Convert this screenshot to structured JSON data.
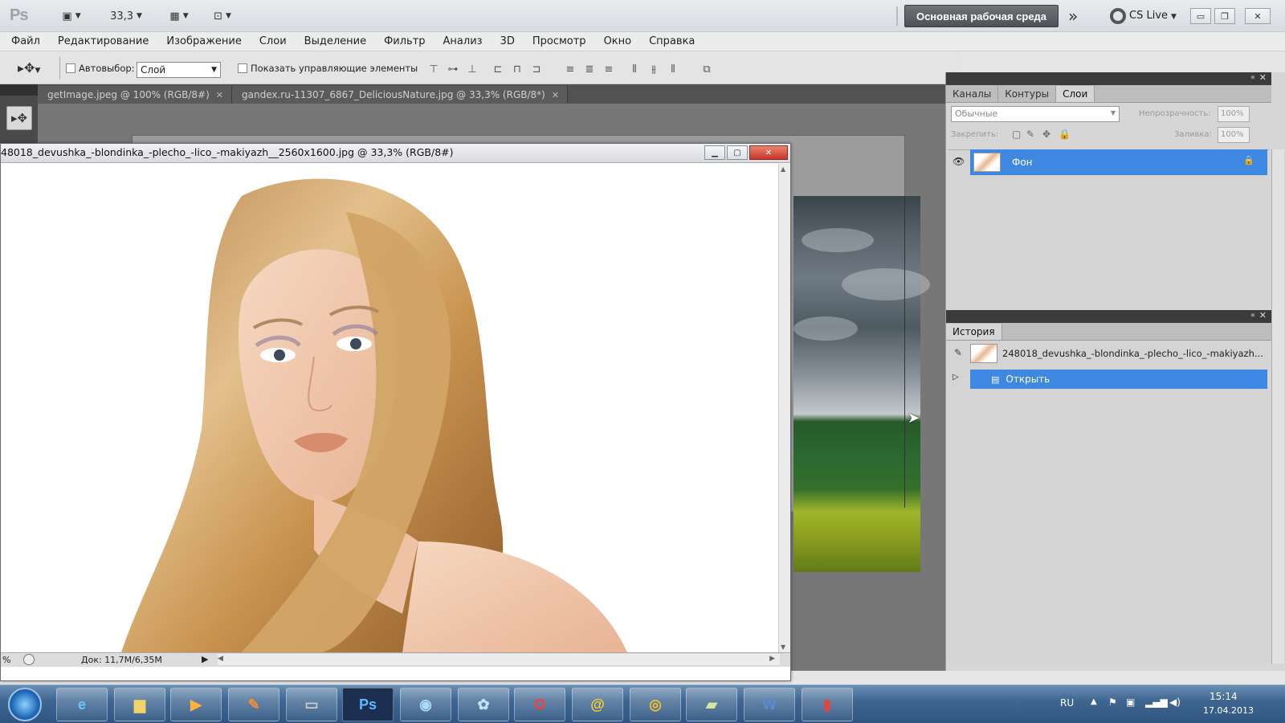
{
  "app": {
    "logo": "Ps",
    "zoom": "33,3",
    "workspace_label": "Основная рабочая среда",
    "cslive_label": "CS Live"
  },
  "menu": [
    "Файл",
    "Редактирование",
    "Изображение",
    "Слои",
    "Выделение",
    "Фильтр",
    "Анализ",
    "3D",
    "Просмотр",
    "Окно",
    "Справка"
  ],
  "options": {
    "autoselect_label": "Автовыбор:",
    "autoselect_value": "Слой",
    "show_controls_label": "Показать управляющие элементы"
  },
  "doc_tabs": [
    {
      "label": "getImage.jpeg @ 100% (RGB/8#)"
    },
    {
      "label": "gandex.ru-11307_6867_DeliciousNature.jpg @ 33,3% (RGB/8*)"
    }
  ],
  "active_doc": {
    "title": "48018_devushka_-blondinka_-plecho_-lico_-makiyazh__2560x1600.jpg @ 33,3% (RGB/8#)",
    "zoom_status": "%",
    "doc_size": "Док: 11,7M/6,35M"
  },
  "layers_panel": {
    "tabs": [
      "Каналы",
      "Контуры",
      "Слои"
    ],
    "blend_mode": "Обычные",
    "opacity_label": "Непрозрачность:",
    "opacity_value": "100%",
    "lock_label": "Закрепить:",
    "fill_label": "Заливка:",
    "fill_value": "100%",
    "layers": [
      {
        "name": "Фон",
        "selected": true
      }
    ]
  },
  "history_panel": {
    "tab": "История",
    "snapshot": "248018_devushka_-blondinka_-plecho_-lico_-makiyazh...",
    "items": [
      {
        "name": "Открыть",
        "selected": true
      }
    ]
  },
  "taskbar": {
    "apps": [
      "start",
      "internet-explorer",
      "explorer",
      "media-player",
      "paint",
      "terminal",
      "photoshop",
      "app-round",
      "app-fan",
      "opera",
      "mail-agent",
      "chrome",
      "notes",
      "word",
      "video-tool"
    ],
    "ps_label": "Ps",
    "lang": "RU",
    "time": "15:14",
    "date": "17.04.2013"
  }
}
